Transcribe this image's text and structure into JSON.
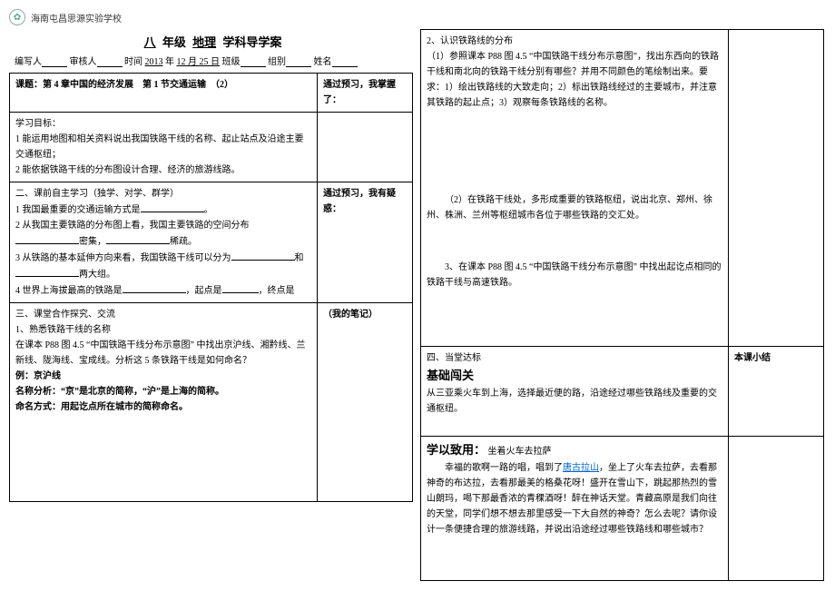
{
  "school_name": "海南屯昌思源实验学校",
  "title": {
    "grade": "八",
    "grade_suffix": "年级",
    "subject": "地理",
    "doc": "学科导学案"
  },
  "meta": {
    "writer_label": "编写人",
    "reviewer_label": "审核人",
    "time_label": "时间",
    "year": "2013",
    "year_suf": "年",
    "date": "12 月 25 日",
    "class_label": "班级",
    "group_label": "组别",
    "name_label": "姓名"
  },
  "row1": {
    "topic_label": "课题：",
    "topic": "第 4 章中国的经济发展　第 1 节交通运输　（2）",
    "right": "通过预习，我掌握了："
  },
  "row2": {
    "head": "学习目标：",
    "g1": "1 能运用地图和相关资料说出我国铁路干线的名称、起止站点及沿途主要交通枢纽；",
    "g2": "2 能依据铁路干线的分布图设计合理、经济的旅游线路。"
  },
  "row3": {
    "head": "二、课前自主学习（独学、对学、群学）",
    "q1a": "1 我国最重要的交通运输方式是",
    "q1b": "。",
    "q2": "2 从我国主要铁路的分布图上看，我国主要铁路的空间分布",
    "q2b1": "密集，",
    "q2b2": "稀疏。",
    "q3a": "3 从铁路的基本延伸方向来看，我国铁路干线可以分为",
    "q3b": "和",
    "q3c": "两大组。",
    "q4a": "4 世界上海拔最高的铁路是",
    "q4b": "，起点是",
    "q4c": "，终点是",
    "right": "通过预习，我有疑惑："
  },
  "row4": {
    "head": "三、课堂合作探究、交流",
    "l1": "1、熟悉铁路干线的名称",
    "l2": "在课本 P88 图 4.5 “中国铁路干线分布示意图” 中找出京沪线、湘黔线、兰新线、陇海线、宝成线。分析这 5 条铁路干线是如何命名？",
    "l3": "例：京沪线",
    "l4": "名称分析：“京”是北京的简称，“沪”是上海的简称。",
    "l5": "命名方式：用起讫点所在城市的简称命名。",
    "right": "（我的笔记）"
  },
  "p2_row1": {
    "head": "2、认识铁路线的分布",
    "p1": "（1）参照课本 P88 图 4.5 “中国铁路干线分布示意图”，找出东西向的铁路干线和南北向的铁路干线分别有哪些？并用不同颜色的笔绘制出来。要求：1）绘出铁路线的大致走向；2）标出铁路线经过的主要城市，并注意其铁路的起止点；3）观察每条铁路线的名称。",
    "p2": "（2）在铁路干线处，多形成重要的铁路枢纽，说出北京、郑州、徐州、株洲、兰州等枢纽城市各位于哪些铁路的交汇处。",
    "p3": "3、在课本 P88 图 4.5 “中国铁路干线分布示意图” 中找出起讫点相同的铁路干线与高速铁路。"
  },
  "p2_row2": {
    "head1": "四、当堂达标",
    "head2": "基础闯关",
    "text": "从三亚乘火车到上海，选择最近便的路，沿途经过哪些铁路线及重要的交通枢纽。",
    "right": "本课小结"
  },
  "p2_row3": {
    "head": "学以致用：",
    "sub": "坐着火车去拉萨",
    "para": "幸福的歌啊一路的唱，唱到了",
    "link": "唐古拉山",
    "para2": "，坐上了火车去拉萨，去看那神奇的布达拉，去看那最美的格桑花呀！盛开在雪山下，跳起那热烈的雪山朗玛，喝下那最香浓的青稞酒呀！醉在神话天堂。青藏高原是我们向往的天堂，同学们想不想去那里感受一下大自然的神奇？怎么去呢？请你设计一条便捷合理的旅游线路，并说出沿途经过哪些铁路线和哪些城市？"
  }
}
